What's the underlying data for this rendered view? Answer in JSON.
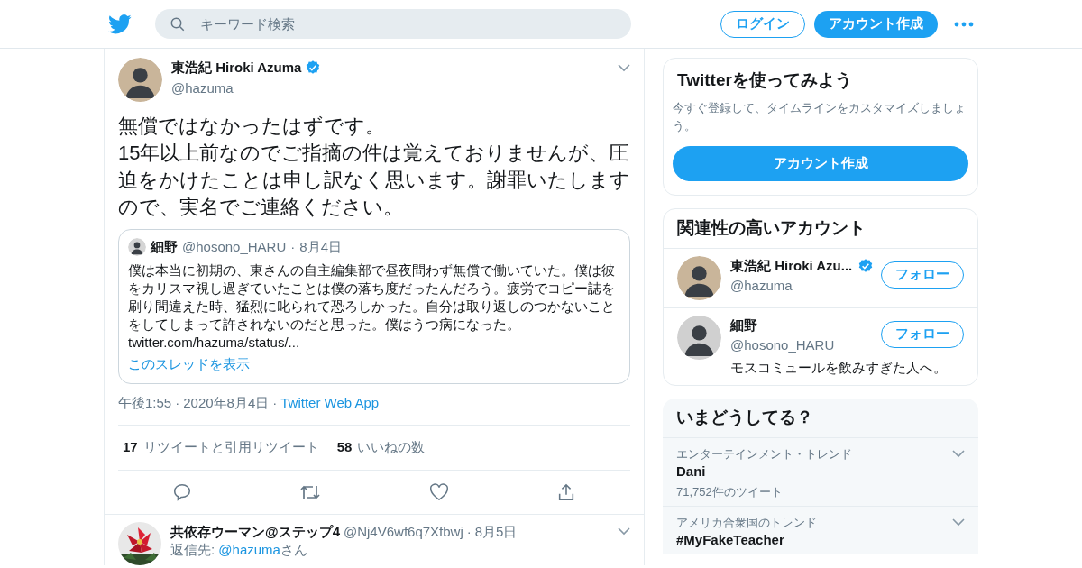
{
  "header": {
    "search": {
      "placeholder": "キーワード検索"
    },
    "login": "ログイン",
    "signup": "アカウント作成"
  },
  "tweet": {
    "name": "東浩紀 Hiroki Azuma",
    "verified": true,
    "handle": "@hazuma",
    "text": "無償ではなかったはずです。\n15年以上前なのでご指摘の件は覚えておりませんが、圧迫をかけたことは申し訳なく思います。謝罪いたしますので、実名でご連絡ください。",
    "quote": {
      "name": "細野",
      "handle": "@hosono_HARU",
      "sep": "·",
      "date": "8月4日",
      "text": "僕は本当に初期の、東さんの自主編集部で昼夜問わず無償で働いていた。僕は彼をカリスマ視し過ぎていたことは僕の落ち度だったんだろう。疲労でコピー誌を刷り間違えた時、猛烈に叱られて恐ろしかった。自分は取り返しのつかないことをしてしまって許されないのだと思った。僕はうつ病になった。",
      "link": "twitter.com/hazuma/status/...",
      "thread": "このスレッドを表示"
    },
    "time": "午後1:55",
    "seps": [
      "·",
      "·"
    ],
    "date": "2020年8月4日",
    "source": "Twitter Web App",
    "stats": [
      {
        "count": "17",
        "label": "リツイートと引用リツイート"
      },
      {
        "count": "58",
        "label": "いいねの数"
      }
    ]
  },
  "reply": {
    "name": "共依存ウーマン@ステップ4",
    "handle": "@Nj4V6wf6q7Xfbwj",
    "sep": "·",
    "date": "8月5日",
    "reply_prefix": "返信先: ",
    "reply_link": "@hazuma",
    "reply_suffix": "さん"
  },
  "signup_card": {
    "title": "Twitterを使ってみよう",
    "text": "今すぐ登録して、タイムラインをカスタマイズしましょう。",
    "button": "アカウント作成"
  },
  "related": {
    "title": "関連性の高いアカウント",
    "accounts": [
      {
        "name": "東浩紀 Hiroki Azu...",
        "verified": true,
        "handle": "@hazuma",
        "follow": "フォロー"
      },
      {
        "name": "細野",
        "verified": false,
        "handle": "@hosono_HARU",
        "follow": "フォロー",
        "bio": "モスコミュールを飲みすぎた人へ。"
      }
    ]
  },
  "trends": {
    "title": "いまどうしてる？",
    "items": [
      {
        "context": "エンターテインメント・トレンド",
        "topic": "Dani",
        "count": "71,752件のツイート"
      },
      {
        "context": "アメリカ合衆国のトレンド",
        "topic": "#MyFakeTeacher"
      }
    ]
  }
}
